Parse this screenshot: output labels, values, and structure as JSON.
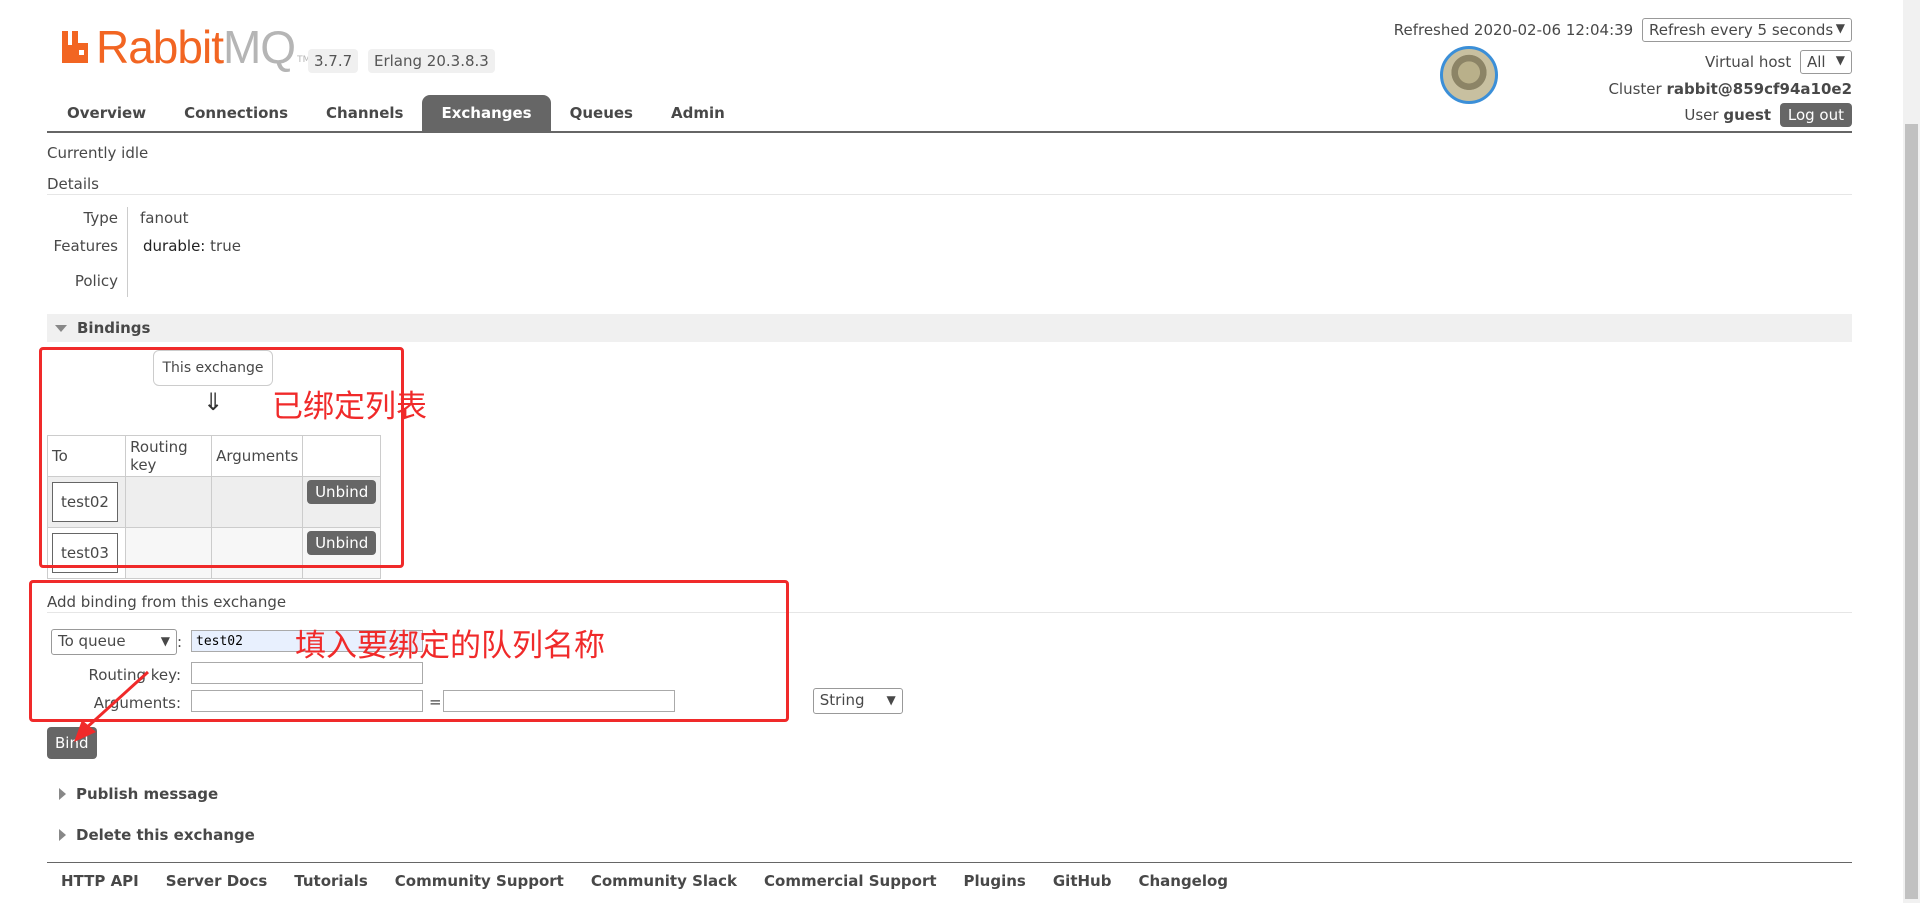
{
  "header": {
    "logo_rabbit": "Rabbit",
    "logo_mq": "MQ",
    "logo_tm": "TM",
    "version": "3.7.7",
    "erlang": "Erlang 20.3.8.3",
    "refreshed": "Refreshed 2020-02-06 12:04:39",
    "refresh_select": "Refresh every 5 seconds",
    "vhost_label": "Virtual host",
    "vhost_select": "All",
    "cluster_label": "Cluster",
    "cluster_name": "rabbit@859cf94a10e2",
    "user_label": "User",
    "user_name": "guest",
    "logout": "Log out"
  },
  "tabs": [
    "Overview",
    "Connections",
    "Channels",
    "Exchanges",
    "Queues",
    "Admin"
  ],
  "active_tab": "Exchanges",
  "status": "Currently idle",
  "details": {
    "title": "Details",
    "type_label": "Type",
    "type_value": "fanout",
    "features_label": "Features",
    "features_key": "durable:",
    "features_value": "true",
    "policy_label": "Policy"
  },
  "bindings": {
    "title": "Bindings",
    "this_exchange": "This exchange",
    "arrow": "⇓",
    "columns": [
      "To",
      "Routing key",
      "Arguments",
      ""
    ],
    "rows": [
      {
        "to": "test02",
        "unbind": "Unbind"
      },
      {
        "to": "test03",
        "unbind": "Unbind"
      }
    ]
  },
  "add_binding": {
    "title": "Add binding from this exchange",
    "dest_select": "To queue",
    "colon": ":",
    "dest_value": "test02",
    "routing_key_label": "Routing key:",
    "arguments_label": "Arguments:",
    "equals": "=",
    "type_select": "String",
    "bind_button": "Bind"
  },
  "publish_message": "Publish message",
  "delete_exchange": "Delete this exchange",
  "footer": [
    "HTTP API",
    "Server Docs",
    "Tutorials",
    "Community Support",
    "Community Slack",
    "Commercial Support",
    "Plugins",
    "GitHub",
    "Changelog"
  ],
  "annotations": {
    "bound_list": "已绑定列表",
    "fill_queue": "填入要绑定的队列名称"
  },
  "colors": {
    "brand_orange": "#f26522",
    "tab_active": "#666666",
    "annotation_red": "#f02a2a"
  }
}
